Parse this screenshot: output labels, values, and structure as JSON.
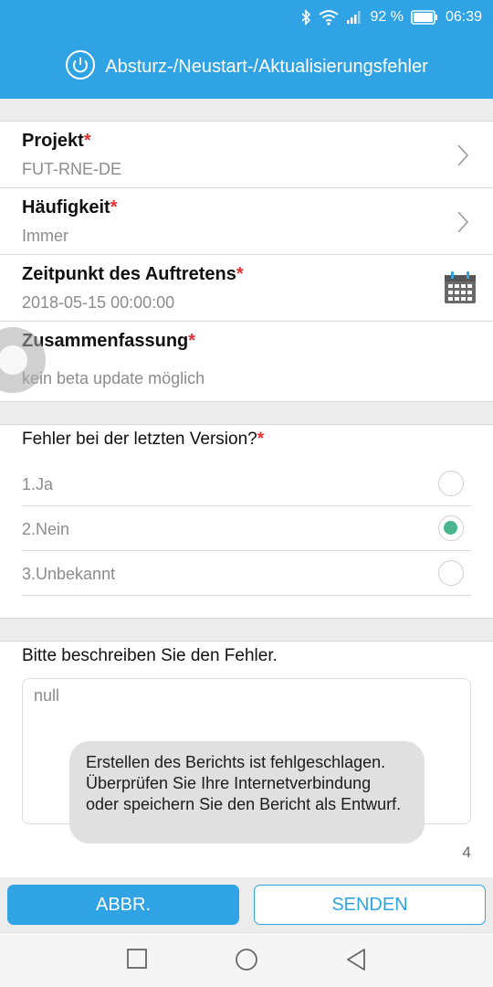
{
  "status_bar": {
    "battery_percent": "92 %",
    "time": "06:39",
    "icons": [
      "bluetooth-icon",
      "wifi-icon",
      "cell-signal-icon",
      "battery-icon"
    ]
  },
  "header": {
    "title": "Absturz-/Neustart-/Aktualisierungsfehler",
    "icon": "power-icon"
  },
  "fields": [
    {
      "label": "Projekt",
      "required_mark": "*",
      "value": "FUT-RNE-DE",
      "icon": "chevron-right-icon"
    },
    {
      "label": "Häufigkeit",
      "required_mark": "*",
      "value": "Immer",
      "icon": "chevron-right-icon"
    },
    {
      "label": "Zeitpunkt des Auftretens",
      "required_mark": "*",
      "value": "2018-05-15 00:00:00",
      "icon": "calendar-icon"
    },
    {
      "label": "Zusammenfassung",
      "required_mark": "*",
      "value": "kein beta update möglich"
    }
  ],
  "question": {
    "text": "Fehler bei der letzten Version?",
    "required_mark": "*",
    "options": [
      {
        "label": "1.Ja",
        "selected": false
      },
      {
        "label": "2.Nein",
        "selected": true
      },
      {
        "label": "3.Unbekannt",
        "selected": false
      }
    ]
  },
  "description": {
    "label": "Bitte beschreiben Sie den Fehler.",
    "value": "null",
    "counter": "4"
  },
  "toast": {
    "message": "Erstellen des Berichts ist fehlgeschlagen. Überprüfen Sie Ihre Internetverbindung oder speichern Sie den Bericht als Entwurf."
  },
  "buttons": {
    "cancel_label": "ABBR.",
    "send_label": "SENDEN"
  },
  "colors": {
    "accent": "#2fa3e3",
    "required": "#e53030",
    "radio_selected": "#49b58e"
  },
  "nav_bar": {
    "icons": [
      "recent-apps-icon",
      "home-icon",
      "back-icon"
    ]
  }
}
